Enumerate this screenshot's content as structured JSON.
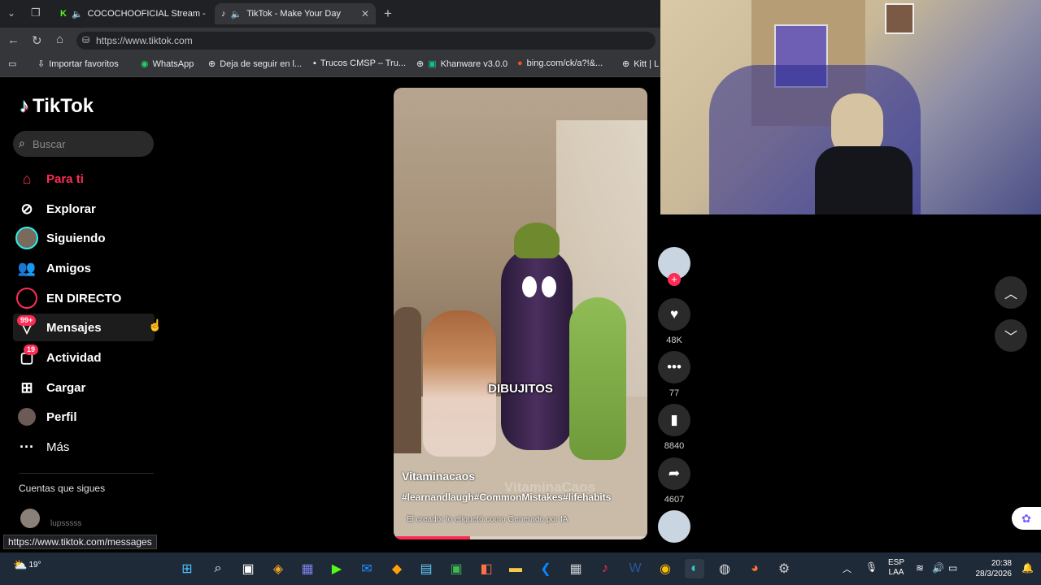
{
  "browser": {
    "tabs": [
      {
        "label": "COCOCHOOFICIAL Stream - Y",
        "active": false
      },
      {
        "label": "TikTok - Make Your Day",
        "active": true
      }
    ],
    "url": "https://www.tiktok.com",
    "bookmarks": [
      "Importar favoritos",
      "WhatsApp",
      "Deja de seguir en l...",
      "Trucos CMSP – Tru...",
      "Khanware v3.0.0",
      "bing.com/ck/a?!&...",
      "Kitt | L"
    ],
    "status_url": "https://www.tiktok.com/messages"
  },
  "tiktok": {
    "logo": "TikTok",
    "search_placeholder": "Buscar",
    "nav": [
      {
        "label": "Para ti",
        "icon": "home-icon",
        "active": true
      },
      {
        "label": "Explorar",
        "icon": "compass-icon"
      },
      {
        "label": "Siguiendo",
        "icon": "following-avatar-icon"
      },
      {
        "label": "Amigos",
        "icon": "friends-icon"
      },
      {
        "label": "EN DIRECTO",
        "icon": "live-icon"
      },
      {
        "label": "Mensajes",
        "icon": "messages-icon",
        "badge": "99+"
      },
      {
        "label": "Actividad",
        "icon": "activity-icon",
        "badge": "19"
      },
      {
        "label": "Cargar",
        "icon": "upload-icon"
      },
      {
        "label": "Perfil",
        "icon": "profile-avatar-icon"
      },
      {
        "label": "Más",
        "icon": "more-icon"
      }
    ],
    "following_header": "Cuentas que sigues",
    "following_account": "lupsssss",
    "video": {
      "caption_center": "DIBUJITOS",
      "author": "Vitaminacaos",
      "hashtags": "#learnandlaugh#CommonMistakes#lifehabits",
      "ai_label": "El creador lo etiquetó como Generado por IA",
      "watermark": "VitaminaCaos",
      "progress": 0.3
    },
    "actions": {
      "likes": "48K",
      "comments": "77",
      "saves": "8840",
      "shares": "4607"
    }
  },
  "taskbar": {
    "weather": "19°",
    "lang": "ESP",
    "lang2": "LAA",
    "time": "20:38",
    "date": "28/3/2026"
  },
  "colors": {
    "accent": "#fe2c55",
    "taskbar": "#1f2a38",
    "chrome": "#35363a"
  }
}
